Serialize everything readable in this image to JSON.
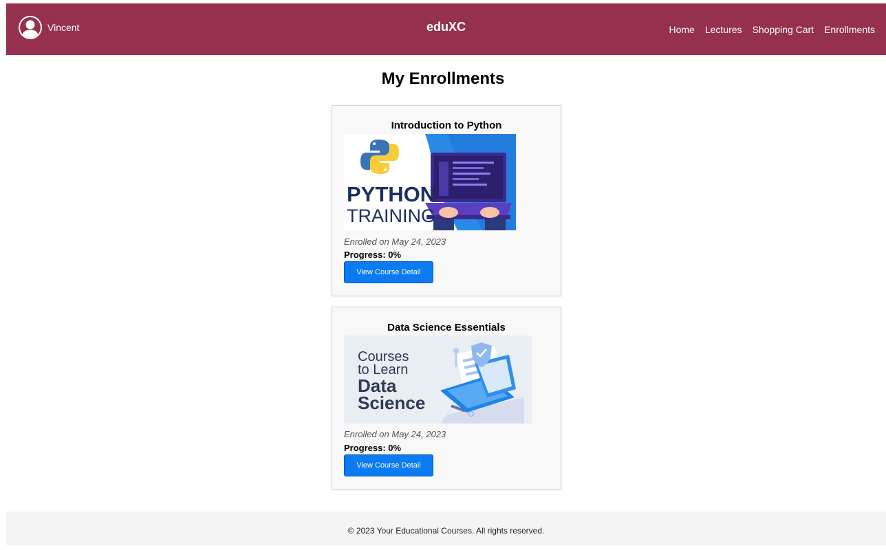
{
  "header": {
    "username": "Vincent",
    "brand": "eduXC",
    "nav": [
      "Home",
      "Lectures",
      "Shopping Cart",
      "Enrollments"
    ],
    "background_color": "#95314e"
  },
  "page": {
    "title": "My Enrollments"
  },
  "enrollments": [
    {
      "title": "Introduction to Python",
      "image_text": [
        "PYTHON",
        "TRAINING"
      ],
      "enrolled": "Enrolled on May 24, 2023",
      "progress_label": "Progress: 0%",
      "progress_value": 0,
      "button": "View Course Detail"
    },
    {
      "title": "Data Science Essentials",
      "image_text": [
        "Courses",
        "to Learn",
        "Data",
        "Science"
      ],
      "enrolled": "Enrolled on May 24, 2023",
      "progress_label": "Progress: 0%",
      "progress_value": 0,
      "button": "View Course Detail"
    }
  ],
  "footer": {
    "text": "© 2023 Your Educational Courses. All rights reserved."
  },
  "colors": {
    "accent": "#0a7bf2",
    "card_background": "#f8f8f8",
    "footer_background": "#f4f4f4"
  }
}
